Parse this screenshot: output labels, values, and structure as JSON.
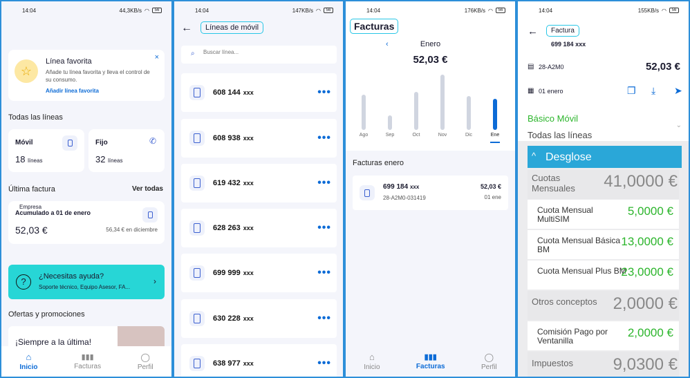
{
  "colors": {
    "accent": "#0c6bd6",
    "help_bg": "#27d6d6",
    "green": "#2cb52c",
    "desglose_bg": "#2aa7d8"
  },
  "panel1": {
    "status_time": "14:04",
    "status_speed": "44,3KB/s",
    "battery": "56",
    "fav_title": "Línea favorita",
    "fav_desc": "Añade tu línea favorita y lleva el control de su consumo.",
    "fav_link": "Añadir línea favorita",
    "fav_close": "×",
    "all_lines": "Todas las líneas",
    "mobile_title": "Móvil",
    "mobile_count": "18",
    "mobile_unit": "líneas",
    "fixed_title": "Fijo",
    "fixed_count": "32",
    "fixed_unit": "líneas",
    "last_invoice": "Última factura",
    "see_all": "Ver todas",
    "company": "Empresa",
    "accum": "Acumulado a 01 de enero",
    "amount": "52,03 €",
    "prev": "56,34 € en diciembre",
    "help_title": "¿Necesitas ayuda?",
    "help_sub": "Soporte técnico, Equipo Asesor, FA...",
    "offers": "Ofertas y promociones",
    "promo": "¡Siempre a la última!",
    "tabs": [
      {
        "label": "Inicio"
      },
      {
        "label": "Facturas"
      },
      {
        "label": "Perfil"
      }
    ]
  },
  "panel2": {
    "status_time": "14:04",
    "status_speed": "147KB/s",
    "battery": "56",
    "title": "Líneas de móvil",
    "search_placeholder": "Buscar línea...",
    "lines": [
      {
        "num": "608 144",
        "suffix": "xxx"
      },
      {
        "num": "608 938",
        "suffix": "xxx"
      },
      {
        "num": "619 432",
        "suffix": "xxx"
      },
      {
        "num": "628 263",
        "suffix": "xxx"
      },
      {
        "num": "699 999",
        "suffix": "xxx"
      },
      {
        "num": "630 228",
        "suffix": "xxx"
      },
      {
        "num": "638 977",
        "suffix": "xxx"
      }
    ],
    "dots": "•••"
  },
  "panel3": {
    "status_time": "14:04",
    "status_speed": "176KB/s",
    "battery": "56",
    "title": "Facturas",
    "month": "Enero",
    "amount": "52,03 €",
    "chart_data": {
      "type": "bar",
      "categories": [
        "Ago",
        "Sep",
        "Oct",
        "Nov",
        "Dic",
        "Ene"
      ],
      "values": [
        52,
        22,
        56,
        82,
        50,
        46
      ],
      "selected": "Ene"
    },
    "section": "Facturas enero",
    "invoice": {
      "line": "699 184",
      "suffix": "xxx",
      "ref": "28-A2M0-031419",
      "amount": "52,03 €",
      "date": "01 ene"
    },
    "tabs": [
      {
        "label": "Inicio"
      },
      {
        "label": "Facturas"
      },
      {
        "label": "Perfil"
      }
    ]
  },
  "panel4": {
    "status_time": "14:04",
    "status_speed": "155KB/s",
    "battery": "56",
    "title": "Factura",
    "line": "699 184",
    "suffix": "xxx",
    "ref": "28-A2M0",
    "amount": "52,03 €",
    "date": "01 enero",
    "plan": "Básico Móvil",
    "all_lines": "Todas las líneas",
    "desglose": "Desglose",
    "rows": [
      {
        "label": "Cuotas Mensuales",
        "value": "41,0000 €",
        "kind": "grey"
      },
      {
        "label": "Cuota Mensual MultiSIM",
        "value": "5,0000 €",
        "kind": "white"
      },
      {
        "label": "Cuota Mensual Básica BM",
        "value": "13,0000 €",
        "kind": "white"
      },
      {
        "label": "Cuota Mensual Plus BM",
        "value": "23,0000 €",
        "kind": "white"
      },
      {
        "label": "Otros conceptos",
        "value": "2,0000 €",
        "kind": "grey"
      },
      {
        "label": "Comisión Pago por Ventanilla",
        "value": "2,0000 €",
        "kind": "white"
      },
      {
        "label": "Impuestos",
        "value": "9,0300 €",
        "kind": "grey"
      }
    ]
  }
}
